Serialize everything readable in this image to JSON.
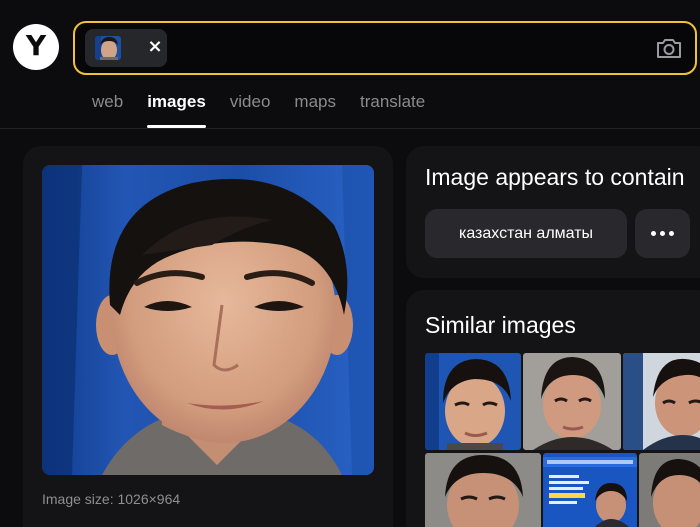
{
  "header": {
    "logo_letter": "Y",
    "search": {
      "chip_close": "×"
    }
  },
  "tabs": [
    {
      "label": "web",
      "active": false
    },
    {
      "label": "images",
      "active": true
    },
    {
      "label": "video",
      "active": false
    },
    {
      "label": "maps",
      "active": false
    },
    {
      "label": "translate",
      "active": false
    }
  ],
  "preview": {
    "image_size_label": "Image size: 1026×964"
  },
  "recognition": {
    "title": "Image appears to contain",
    "tag": "казахстан алматы",
    "more_icon": "more-dots-icon"
  },
  "similar": {
    "title": "Similar images"
  },
  "colors": {
    "accent": "#f1c232",
    "background": "#0c0c0e",
    "card": "#141416",
    "button": "#29292d"
  }
}
